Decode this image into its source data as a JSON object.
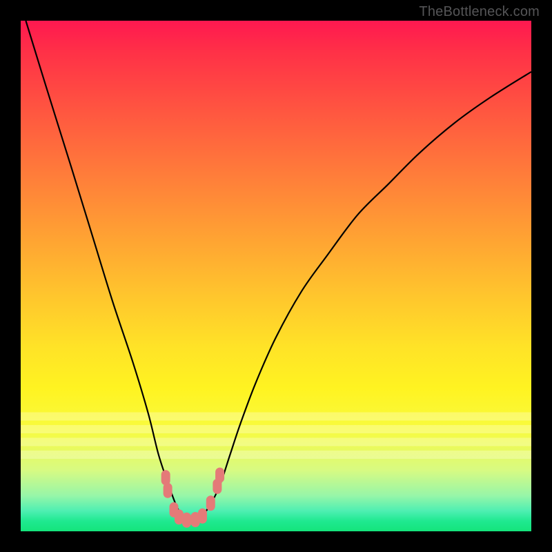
{
  "watermark": "TheBottleneck.com",
  "colors": {
    "frame": "#000000",
    "curve_stroke": "#000000",
    "marker_fill": "#e47a78",
    "marker_stroke": "#c85a58"
  },
  "chart_data": {
    "type": "line",
    "title": "",
    "xlabel": "",
    "ylabel": "",
    "xlim": [
      0,
      100
    ],
    "ylim": [
      0,
      100
    ],
    "grid": false,
    "legend": false,
    "series": [
      {
        "name": "bottleneck-curve",
        "x": [
          1,
          5,
          10,
          14,
          18,
          22,
          25,
          27,
          29,
          30.5,
          32,
          33.5,
          35,
          37,
          39,
          41,
          43,
          46,
          50,
          55,
          60,
          66,
          72,
          78,
          85,
          92,
          100
        ],
        "values": [
          100,
          87,
          71,
          58,
          45,
          33,
          23,
          15,
          9,
          5,
          2.5,
          2,
          2.5,
          5,
          9,
          15,
          21,
          29,
          38,
          47,
          54,
          62,
          68,
          74,
          80,
          85,
          90
        ]
      }
    ],
    "markers": [
      {
        "x": 28.4,
        "y": 10.5
      },
      {
        "x": 28.8,
        "y": 8.0
      },
      {
        "x": 30.0,
        "y": 4.2
      },
      {
        "x": 31.0,
        "y": 2.8
      },
      {
        "x": 32.5,
        "y": 2.2
      },
      {
        "x": 34.2,
        "y": 2.3
      },
      {
        "x": 35.6,
        "y": 3.0
      },
      {
        "x": 37.2,
        "y": 5.5
      },
      {
        "x": 38.5,
        "y": 8.8
      },
      {
        "x": 39.0,
        "y": 11.0
      }
    ],
    "light_bands_y": [
      22.5,
      20.0,
      17.5,
      15.0
    ]
  }
}
